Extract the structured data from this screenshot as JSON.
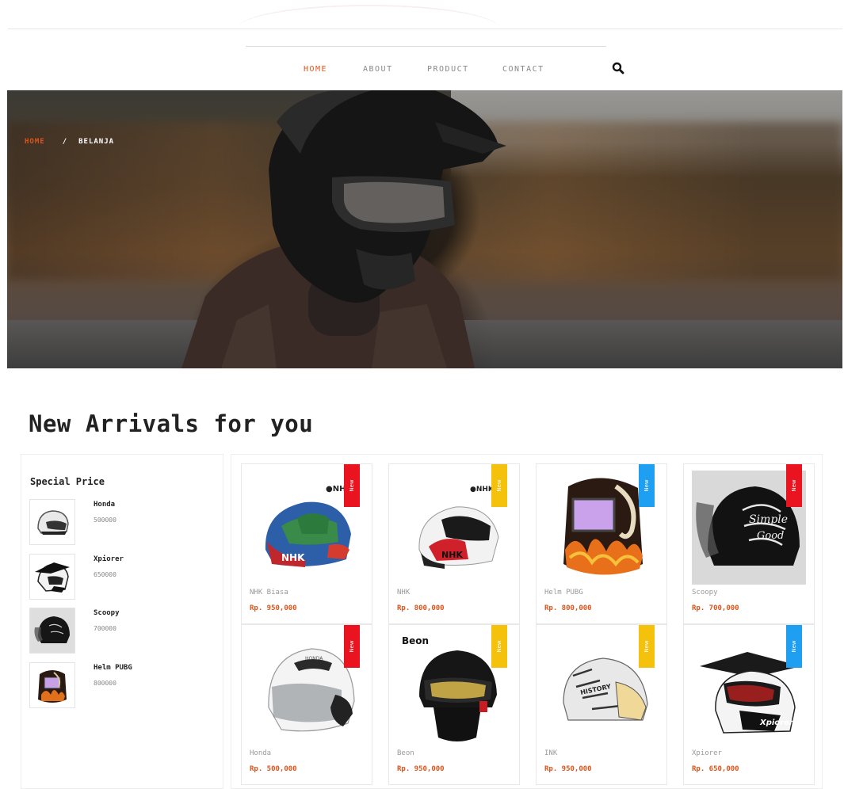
{
  "nav": {
    "items": [
      {
        "label": "HOME",
        "active": true
      },
      {
        "label": "ABOUT",
        "active": false
      },
      {
        "label": "PRODUCT",
        "active": false
      },
      {
        "label": "CONTACT",
        "active": false
      }
    ],
    "search_icon": "search-icon"
  },
  "breadcrumb": {
    "home": "HOME",
    "separator": "/",
    "current": "BELANJA"
  },
  "section": {
    "title": "New Arrivals for you"
  },
  "special_price": {
    "title": "Special Price",
    "items": [
      {
        "name": "Honda",
        "price": "500000"
      },
      {
        "name": "Xpiorer",
        "price": "650000"
      },
      {
        "name": "Scoopy",
        "price": "700000"
      },
      {
        "name": "Helm PUBG",
        "price": "800000"
      }
    ]
  },
  "products": [
    {
      "name": "NHK Biasa",
      "price": "Rp. 950,000",
      "badge": "New",
      "badge_color": "#ea1421"
    },
    {
      "name": "NHK",
      "price": "Rp. 800,000",
      "badge": "New",
      "badge_color": "#f4c20d"
    },
    {
      "name": "Helm PUBG",
      "price": "Rp. 800,000",
      "badge": "New",
      "badge_color": "#1e9ff2"
    },
    {
      "name": "Scoopy",
      "price": "Rp. 700,000",
      "badge": "New",
      "badge_color": "#ea1421"
    },
    {
      "name": "Honda",
      "price": "Rp. 500,000",
      "badge": "New",
      "badge_color": "#ea1421"
    },
    {
      "name": "Beon",
      "price": "Rp. 950,000",
      "badge": "New",
      "badge_color": "#f4c20d"
    },
    {
      "name": "INK",
      "price": "Rp. 950,000",
      "badge": "New",
      "badge_color": "#f4c20d"
    },
    {
      "name": "Xpiorer",
      "price": "Rp. 650,000",
      "badge": "New",
      "badge_color": "#1e9ff2"
    }
  ],
  "colors": {
    "accent": "#e0541b",
    "badge_red": "#ea1421",
    "badge_yellow": "#f4c20d",
    "badge_blue": "#1e9ff2"
  }
}
